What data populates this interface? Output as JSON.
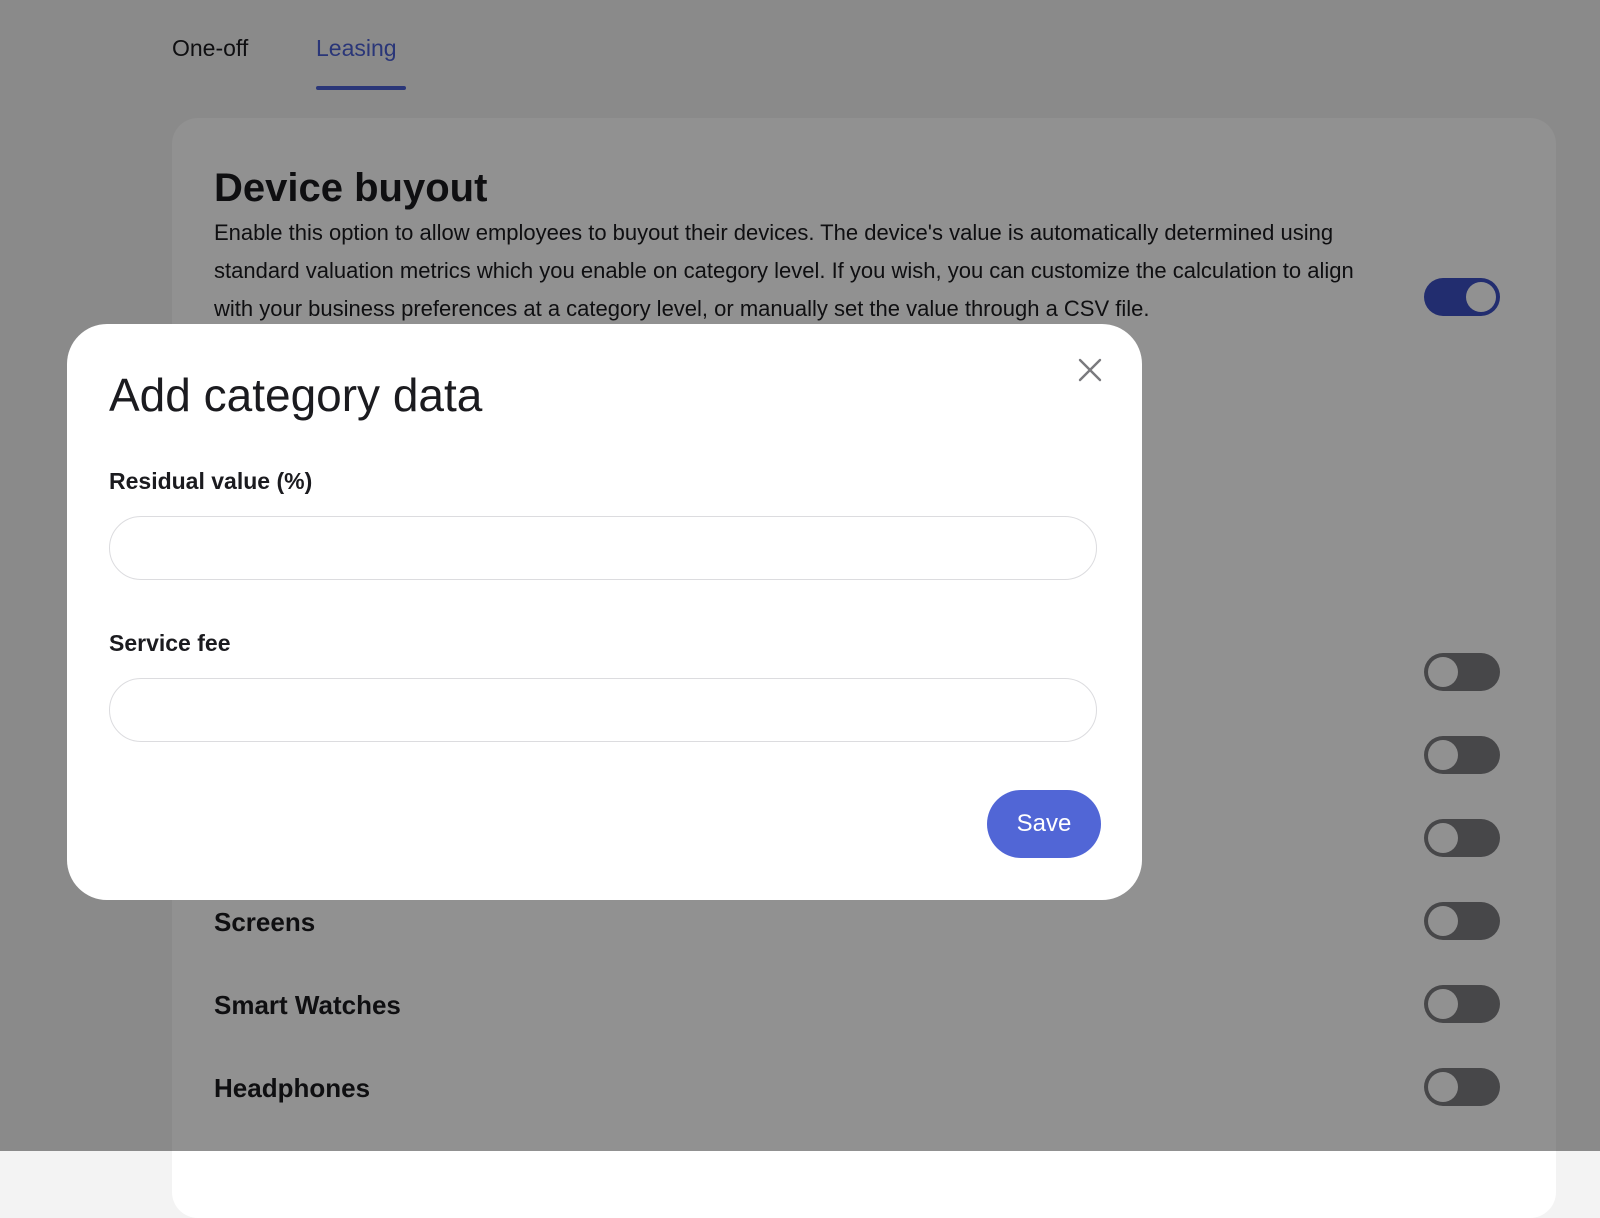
{
  "tabs": [
    {
      "label": "One-off",
      "active": false
    },
    {
      "label": "Leasing",
      "active": true
    }
  ],
  "section": {
    "title": "Device buyout",
    "description": "Enable this option to allow employees to buyout their devices. The device's value is automatically determined using standard valuation metrics which you enable on category level. If you wish, you can customize the calculation to align with your business preferences at a category level, or manually set the value through a CSV file.",
    "buyout_enabled": true
  },
  "categories": [
    {
      "label": "",
      "enabled": false
    },
    {
      "label": "",
      "enabled": false
    },
    {
      "label": "",
      "enabled": false
    },
    {
      "label": "Screens",
      "enabled": false
    },
    {
      "label": "Smart Watches",
      "enabled": false
    },
    {
      "label": "Headphones",
      "enabled": false
    }
  ],
  "modal": {
    "title": "Add category data",
    "fields": [
      {
        "label": "Residual value (%)",
        "value": "",
        "placeholder": ""
      },
      {
        "label": "Service fee",
        "value": "",
        "placeholder": ""
      }
    ],
    "save_label": "Save",
    "close_icon": "close-icon"
  },
  "colors": {
    "accent": "#4a5fd4",
    "toggle_on": "#3d50c4",
    "toggle_off": "#7d7d80",
    "save_button": "#5166d6"
  }
}
